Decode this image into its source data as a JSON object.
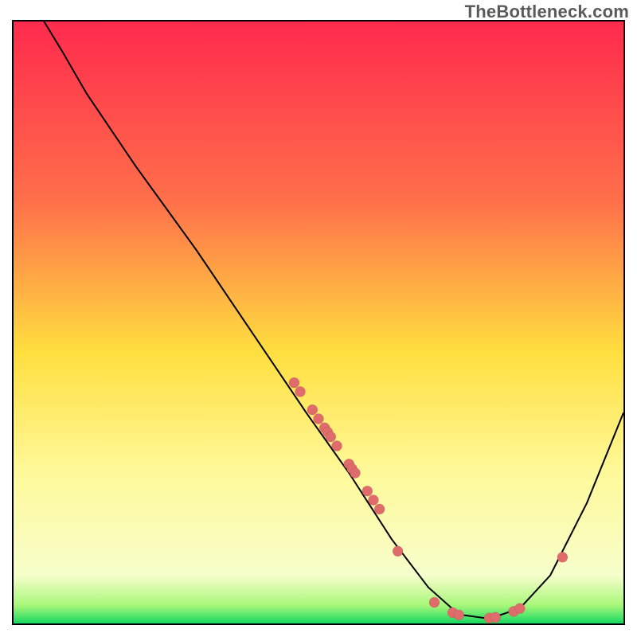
{
  "watermark": "TheBottleneck.com",
  "chart_data": {
    "type": "line",
    "title": "",
    "xlabel": "",
    "ylabel": "",
    "xlim": [
      0,
      100
    ],
    "ylim": [
      0,
      100
    ],
    "grid": false,
    "legend": false,
    "background_gradient": {
      "stops": [
        {
          "offset": 0.0,
          "color": "#ff2a4d"
        },
        {
          "offset": 0.3,
          "color": "#ff704a"
        },
        {
          "offset": 0.55,
          "color": "#ffdf3f"
        },
        {
          "offset": 0.75,
          "color": "#fff99a"
        },
        {
          "offset": 0.92,
          "color": "#f6fecb"
        },
        {
          "offset": 0.97,
          "color": "#a8f77a"
        },
        {
          "offset": 1.0,
          "color": "#16d862"
        }
      ]
    },
    "curve": [
      {
        "x": 5,
        "y": 100
      },
      {
        "x": 8,
        "y": 95
      },
      {
        "x": 12,
        "y": 88
      },
      {
        "x": 20,
        "y": 76
      },
      {
        "x": 30,
        "y": 62
      },
      {
        "x": 40,
        "y": 47
      },
      {
        "x": 48,
        "y": 35
      },
      {
        "x": 55,
        "y": 25
      },
      {
        "x": 62,
        "y": 14
      },
      {
        "x": 68,
        "y": 6
      },
      {
        "x": 73,
        "y": 1.5
      },
      {
        "x": 78,
        "y": 0.8
      },
      {
        "x": 83,
        "y": 2.5
      },
      {
        "x": 88,
        "y": 8
      },
      {
        "x": 94,
        "y": 20
      },
      {
        "x": 100,
        "y": 35
      }
    ],
    "points": [
      {
        "x": 46,
        "y": 40
      },
      {
        "x": 47,
        "y": 38.5
      },
      {
        "x": 49,
        "y": 35.5
      },
      {
        "x": 50,
        "y": 34
      },
      {
        "x": 51,
        "y": 32.5
      },
      {
        "x": 51.5,
        "y": 31.8
      },
      {
        "x": 52,
        "y": 31
      },
      {
        "x": 53,
        "y": 29.5
      },
      {
        "x": 55,
        "y": 26.5
      },
      {
        "x": 55.5,
        "y": 25.7
      },
      {
        "x": 56,
        "y": 25
      },
      {
        "x": 58,
        "y": 22
      },
      {
        "x": 59,
        "y": 20.5
      },
      {
        "x": 60,
        "y": 19
      },
      {
        "x": 63,
        "y": 12
      },
      {
        "x": 69,
        "y": 3.5
      },
      {
        "x": 72,
        "y": 1.8
      },
      {
        "x": 73,
        "y": 1.4
      },
      {
        "x": 78,
        "y": 0.9
      },
      {
        "x": 79,
        "y": 1.0
      },
      {
        "x": 82,
        "y": 2.0
      },
      {
        "x": 83,
        "y": 2.5
      },
      {
        "x": 90,
        "y": 11
      }
    ]
  }
}
